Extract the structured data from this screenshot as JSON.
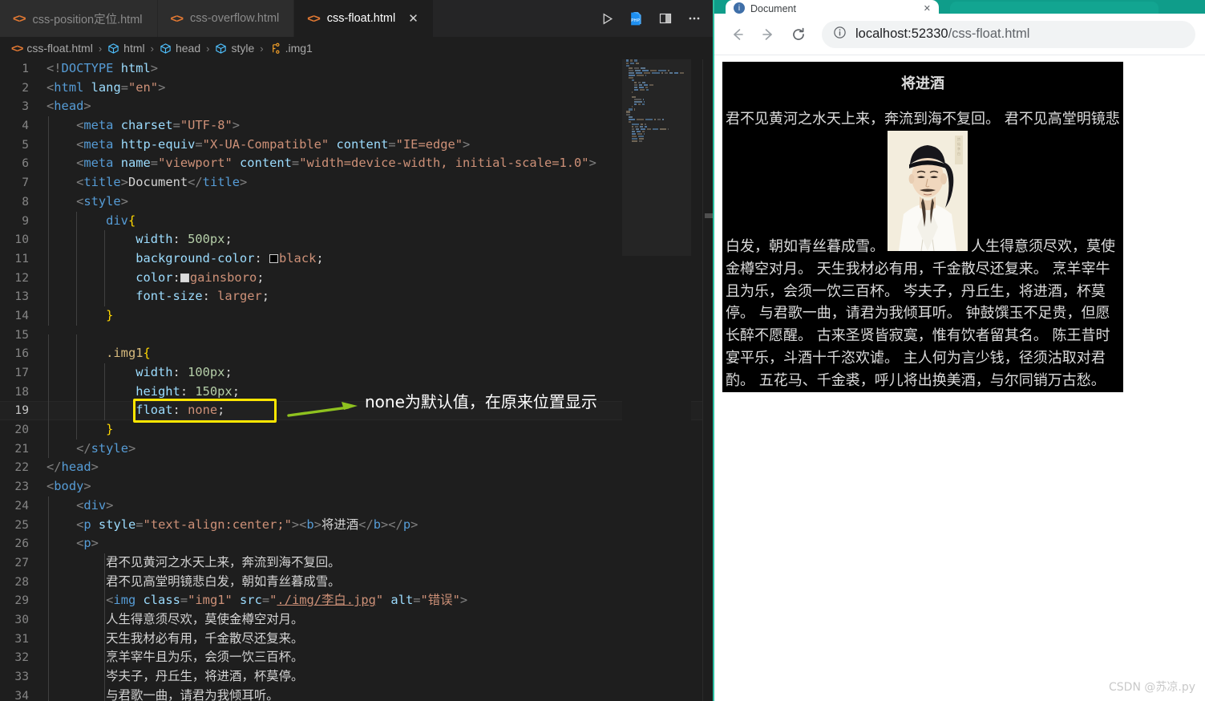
{
  "editor": {
    "tabs": [
      {
        "label": "css-position定位.html",
        "icon": "html-file-icon",
        "active": false,
        "closable": false
      },
      {
        "label": "css-overflow.html",
        "icon": "html-file-icon",
        "active": false,
        "closable": false
      },
      {
        "label": "css-float.html",
        "icon": "html-file-icon",
        "active": true,
        "closable": true,
        "close_label": "✕"
      }
    ],
    "tab_actions": [
      {
        "name": "run-button",
        "label": "▷"
      },
      {
        "name": "php-server-button",
        "label": "PHP"
      },
      {
        "name": "split-editor-button",
        "label": "▯▯"
      },
      {
        "name": "more-actions-button",
        "label": "···"
      }
    ],
    "breadcrumb": [
      {
        "label": "css-float.html",
        "icon": "html-file-icon"
      },
      {
        "label": "html",
        "icon": "symbol-field-icon"
      },
      {
        "label": "head",
        "icon": "symbol-field-icon"
      },
      {
        "label": "style",
        "icon": "symbol-field-icon"
      },
      {
        "label": ".img1",
        "icon": "symbol-class-icon"
      }
    ],
    "breadcrumb_separator": "›",
    "lines": [
      {
        "n": "1",
        "code": "<!DOCTYPE html>"
      },
      {
        "n": "2",
        "code": "<html lang=\"en\">"
      },
      {
        "n": "3",
        "code": "<head>"
      },
      {
        "n": "4",
        "code": "    <meta charset=\"UTF-8\">"
      },
      {
        "n": "5",
        "code": "    <meta http-equiv=\"X-UA-Compatible\" content=\"IE=edge\">"
      },
      {
        "n": "6",
        "code": "    <meta name=\"viewport\" content=\"width=device-width, initial-scale=1.0\">"
      },
      {
        "n": "7",
        "code": "    <title>Document</title>"
      },
      {
        "n": "8",
        "code": "    <style>"
      },
      {
        "n": "9",
        "code": "        div{"
      },
      {
        "n": "10",
        "code": "            width: 500px;"
      },
      {
        "n": "11",
        "code": "            background-color: black;"
      },
      {
        "n": "12",
        "code": "            color: gainsboro;"
      },
      {
        "n": "13",
        "code": "            font-size: larger;"
      },
      {
        "n": "14",
        "code": "        }"
      },
      {
        "n": "15",
        "code": ""
      },
      {
        "n": "16",
        "code": "        .img1{"
      },
      {
        "n": "17",
        "code": "            width: 100px;"
      },
      {
        "n": "18",
        "code": "            height: 150px;"
      },
      {
        "n": "19",
        "code": "            float: none;"
      },
      {
        "n": "20",
        "code": "        }"
      },
      {
        "n": "21",
        "code": "    </style>"
      },
      {
        "n": "22",
        "code": "</head>"
      },
      {
        "n": "23",
        "code": "<body>"
      },
      {
        "n": "24",
        "code": "    <div>"
      },
      {
        "n": "25",
        "code": "    <p style=\"text-align:center;\"><b>将进酒</b></p>"
      },
      {
        "n": "26",
        "code": "    <p>"
      },
      {
        "n": "27",
        "code": "        君不见黄河之水天上来，奔流到海不复回。"
      },
      {
        "n": "28",
        "code": "        君不见高堂明镜悲白发，朝如青丝暮成雪。"
      },
      {
        "n": "29",
        "code": "        <img class=\"img1\" src=\"./img/李白.jpg\" alt=\"错误\">"
      },
      {
        "n": "30",
        "code": "        人生得意须尽欢，莫使金樽空对月。"
      },
      {
        "n": "31",
        "code": "        天生我材必有用，千金散尽还复来。"
      },
      {
        "n": "32",
        "code": "        烹羊宰牛且为乐，会须一饮三百杯。"
      },
      {
        "n": "33",
        "code": "        岑夫子，丹丘生，将进酒，杯莫停。"
      },
      {
        "n": "34",
        "code": "        与君歌一曲，请君为我倾耳听。"
      }
    ],
    "annotation": {
      "highlighted_code": "float: none;",
      "text": "none为默认值，在原来位置显示",
      "box_color": "#ffe600",
      "arrow_color": "#8fc21f"
    }
  },
  "browser": {
    "tab_title": "Document",
    "tab_close_label": "✕",
    "nav": {
      "back_label": "←",
      "forward_label": "→",
      "reload_label": "⟳",
      "info_label": "ⓘ"
    },
    "url_host": "localhost:52330",
    "url_path": "/css-float.html",
    "url_full": "localhost:52330/css-float.html",
    "theme_color": "#0f9d8a"
  },
  "rendered_page": {
    "title": "将进酒",
    "image_alt": "错误",
    "image_name": "李白.jpg",
    "text_before_image": "君不见黄河之水天上来，奔流到海不复回。 君不见高堂明镜悲白发，朝如青丝暮成雪。",
    "text_after_image": "人生得意须尽欢，莫使金樽空对月。 天生我材必有用，千金散尽还复来。 烹羊宰牛且为乐，会须一饮三百杯。 岑夫子，丹丘生，将进酒，杯莫停。 与君歌一曲，请君为我倾耳听。 钟鼓馔玉不足贵，但愿长醉不愿醒。 古来圣贤皆寂寞，惟有饮者留其名。 陈王昔时宴平乐，斗酒十千恣欢谑。 主人何为言少钱，径须沽取对君酌。 五花马、千金裘，呼儿将出换美酒，与尔同销万古愁。",
    "background_color": "#000000",
    "text_color": "#dcdcdc"
  },
  "watermark": "CSDN @苏凉.py"
}
